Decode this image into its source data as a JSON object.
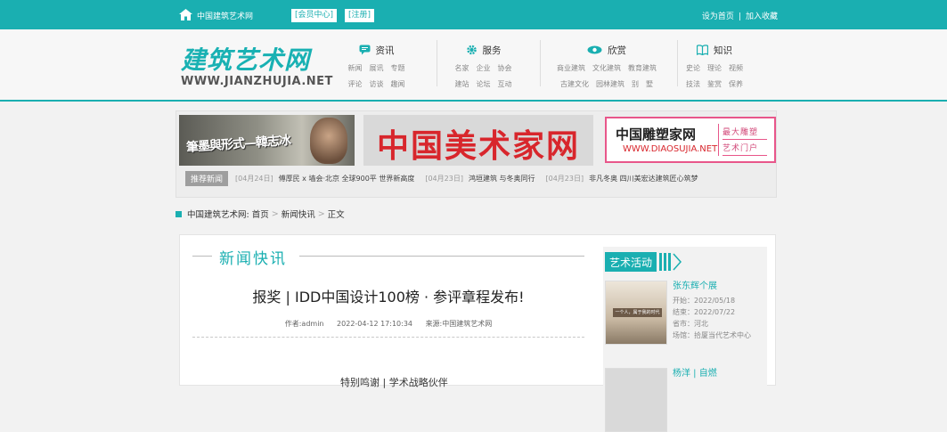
{
  "topbar": {
    "site_name": "中国建筑艺术网",
    "member_center": "[会员中心]",
    "register": "[注册]",
    "set_home": "设为首页",
    "separator": "|",
    "add_favorite": "加入收藏",
    "bg_color": "#1aafb1"
  },
  "logo": {
    "cn": "建筑艺术网",
    "en": "WWW.JIANZHUJIA.NET"
  },
  "nav": [
    {
      "title": "资讯",
      "icon": "chat-icon",
      "row1": [
        "新闻",
        "展讯",
        "专题"
      ],
      "row2": [
        "评论",
        "访谈",
        "趣闻"
      ]
    },
    {
      "title": "服务",
      "icon": "gear-icon",
      "row1": [
        "名家",
        "企业",
        "协会"
      ],
      "row2": [
        "建站",
        "论坛",
        "互动"
      ]
    },
    {
      "title": "欣赏",
      "icon": "eye-icon",
      "row1": [
        "商业建筑",
        "文化建筑",
        "教育建筑"
      ],
      "row2": [
        "古建文化",
        "园林建筑",
        "别　墅"
      ]
    },
    {
      "title": "知识",
      "icon": "book-icon",
      "row1": [
        "史论",
        "理论",
        "视频"
      ],
      "row2": [
        "技法",
        "鉴赏",
        "保养"
      ]
    }
  ],
  "banner": {
    "ad1_text": "筆墨與形式—韓志冰",
    "ad2_text": "中国美术家网",
    "ad3_cn": "中国雕塑家网",
    "ad3_en": "WWW.DIAOSUJIA.NET",
    "ad3_tag1": "最大雕塑",
    "ad3_tag2": "艺术门户"
  },
  "news_ticker": {
    "label": "推荐新闻",
    "items": [
      {
        "date": "[04月24日]",
        "text": "傅厚民 x 墙会·北京 全球900平 世界新高度"
      },
      {
        "date": "[04月23日]",
        "text": "鸿垣建筑 与冬奥同行"
      },
      {
        "date": "[04月23日]",
        "text": "非凡冬奥 四川美宏达建筑匠心筑梦"
      }
    ]
  },
  "breadcrumb": {
    "site": "中国建筑艺术网:",
    "home": "首页",
    "category": "新闻快讯",
    "current": "正文",
    "sep": ">"
  },
  "article": {
    "section": "新闻快讯",
    "title": "报奖 | IDD中国设计100榜 · 参评章程发布!",
    "author": "作者:admin",
    "datetime": "2022-04-12 17:10:34",
    "source": "来源:中国建筑艺术网",
    "body_first_line": "特别鸣谢 | 学术战略伙伴"
  },
  "sidebar": {
    "title": "艺术活动",
    "events": [
      {
        "name": "张东辉个展",
        "thumb_label": "一个人，属于我的时代",
        "start": "开始：2022/05/18",
        "end": "结束：2022/07/22",
        "province": "省市：河北",
        "venue": "场馆：拾厦当代艺术中心"
      },
      {
        "name": "杨洋 | 自燃"
      }
    ]
  }
}
